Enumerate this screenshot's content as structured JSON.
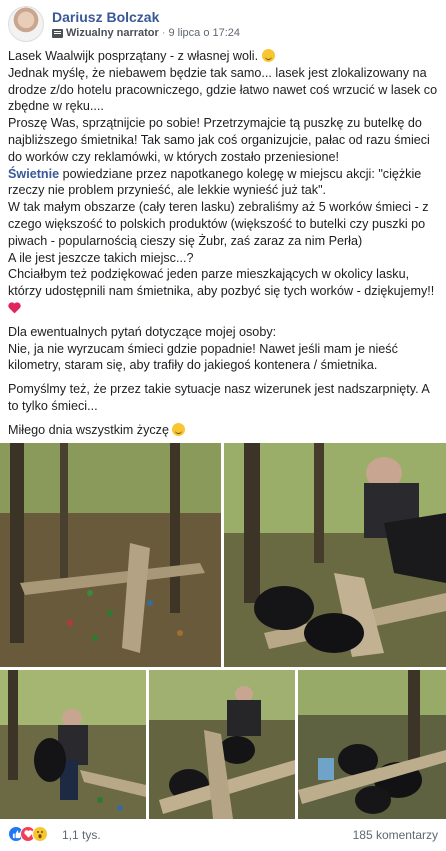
{
  "post": {
    "author": "Dariusz Bolczak",
    "narrator_label": "Wizualny narrator",
    "separator": "·",
    "date": "9 lipca o 17:24"
  },
  "text": {
    "p1_l1": "Lasek Waalwijk posprzątany - z własnej woli. ",
    "p1_l2": "Jednak myślę, że niebawem będzie tak samo... lasek jest zlokalizowany na drodze z/do hotelu pracowniczego, gdzie łatwo nawet coś wrzucić w lasek co zbędne w ręku....",
    "p1_l3": "Proszę Was, sprzątnijcie po sobie! Przetrzymajcie tą puszkę zu butelkę do najbliższego śmietnika! Tak samo jak coś organizujcie, pałac od razu śmieci do worków czy reklamówki, w których zostało przeniesione!",
    "p1_link": "Świetnie",
    "p1_l4": " powiedziane przez napotkanego kolegę w miejscu akcji: \"ciężkie rzeczy nie problem przynieść, ale lekkie wynieść już tak\".",
    "p1_l5": "W tak małym obszarze (cały teren lasku) zebraliśmy aż 5 worków śmieci - z czego większość to polskich produktów (większość to butelki czy puszki po piwach - popularnością cieszy się Żubr, zaś zaraz za nim Perła)",
    "p1_l6": "A ile jest jeszcze takich miejsc...?",
    "p1_l7": "Chciałbym też podziękować jeden parze mieszkających w okolicy lasku, którzy udostępnili nam śmietnika, aby pozbyć się tych worków - dziękujemy!!",
    "p2_l1": "Dla ewentualnych pytań dotyczące mojej osoby:",
    "p2_l2": "Nie, ja nie wyrzucam śmieci gdzie popadnie! Nawet jeśli mam je nieść kilometry, staram się, aby trafiły do jakiegoś kontenera / śmietnika.",
    "p3": "Pomyślmy też, że przez takie sytuacje nasz wizerunek jest nadszarpnięty. A to tylko śmieci...",
    "p4": "Miłego dnia wszystkim życzę "
  },
  "footer": {
    "reaction_count": "1,1 tys.",
    "comments": "185 komentarzy"
  },
  "icons": [
    "like-icon",
    "love-icon",
    "wow-icon",
    "smile-emoji-icon",
    "heart-emoji-icon",
    "flag-icon"
  ]
}
